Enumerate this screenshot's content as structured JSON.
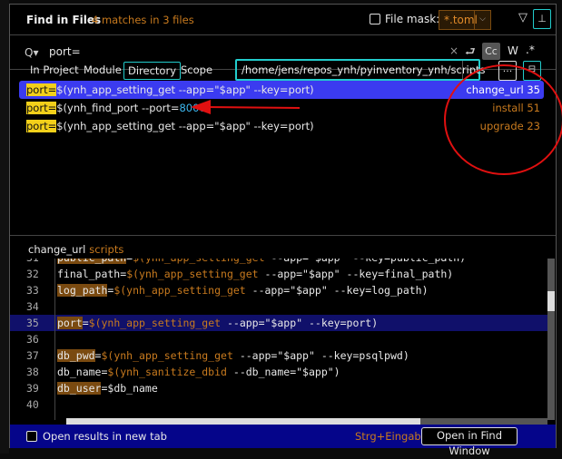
{
  "header": {
    "title": "Find in Files",
    "match_count": "4 matches in 3 files",
    "file_mask_label": "File mask:",
    "file_mask_value": "*.toml",
    "filter_icon": "filter-icon",
    "pin_icon": "pin-icon"
  },
  "search": {
    "value": "port=",
    "clear": "×",
    "cc": "Cc",
    "words": "W",
    "regex": ".*"
  },
  "scope": {
    "tabs": [
      {
        "label": "In Project"
      },
      {
        "label": "Module"
      },
      {
        "label": "Directory",
        "active": true
      },
      {
        "label": "Scope"
      }
    ],
    "directory": "/home/jens/repos_ynh/pyinventory_ynh/scripts",
    "browse": "..."
  },
  "results": [
    {
      "match": "port=",
      "rest": "$(ynh_app_setting_get --app=\"$app\" --key=port)",
      "location": "change_url 35",
      "selected": true
    },
    {
      "match": "port=",
      "rest_a": "$(ynh_find_port --port=",
      "number": "8000",
      "rest_b": ")",
      "location": "install 51"
    },
    {
      "match": "port=",
      "rest": "$(ynh_app_setting_get --app=\"$app\" --key=port)",
      "location": "upgrade 23"
    }
  ],
  "preview": {
    "file": "change_url",
    "folder": "scripts",
    "lines": [
      {
        "n": "31",
        "v": "public_path",
        "r": "=$(ynh_app_setting_get --app=\"$app\" --key=public_path)"
      },
      {
        "n": "32",
        "v": "final_path",
        "r": "=$(ynh_app_setting_get --app=\"$app\" --key=final_path)"
      },
      {
        "n": "33",
        "v": "log_path",
        "r": "=$(ynh_app_setting_get --app=\"$app\" --key=log_path)"
      },
      {
        "n": "34",
        "v": "",
        "r": ""
      },
      {
        "n": "35",
        "v": "port",
        "r": "=$(ynh_app_setting_get --app=\"$app\" --key=port)"
      },
      {
        "n": "36",
        "v": "",
        "r": ""
      },
      {
        "n": "37",
        "v": "db_pwd",
        "r": "=$(ynh_app_setting_get --app=\"$app\" --key=psqlpwd)"
      },
      {
        "n": "38",
        "v": "db_name",
        "r": "=$(ynh_sanitize_dbid --db_name=\"$app\")"
      },
      {
        "n": "39",
        "v": "db_user",
        "r": "=$db_name"
      },
      {
        "n": "40",
        "v": "",
        "r": ""
      }
    ]
  },
  "footer": {
    "new_tab_label": "Open results in new tab",
    "shortcut": "Strg+Eingabe",
    "open_button": "Open in Find Window"
  },
  "colors": {
    "accent": "#22cccc",
    "selection": "#3b3bf0",
    "match_highlight": "#f3d01a",
    "orange": "#c87a1e",
    "footer": "#05058a",
    "annotation": "#e01010"
  }
}
